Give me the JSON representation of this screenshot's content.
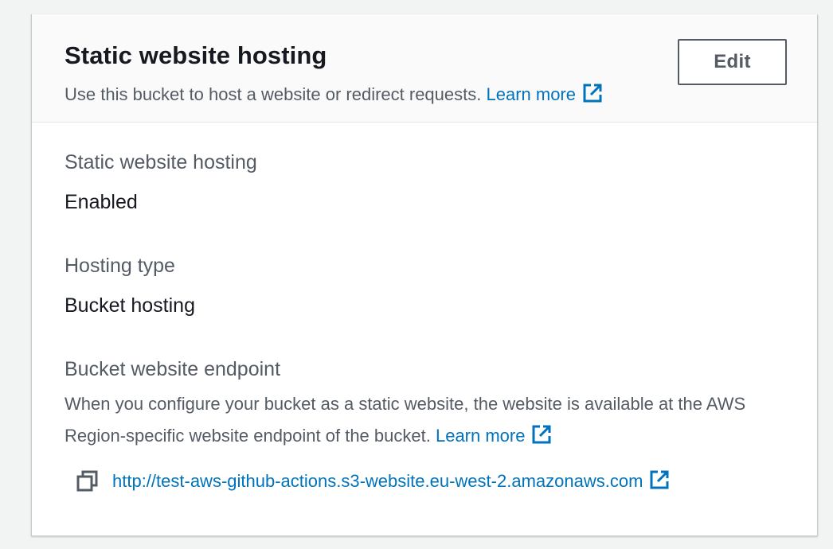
{
  "panel": {
    "title": "Static website hosting",
    "description": "Use this bucket to host a website or redirect requests.",
    "learn_more": "Learn more",
    "edit_label": "Edit"
  },
  "fields": {
    "static_hosting": {
      "label": "Static website hosting",
      "value": "Enabled"
    },
    "hosting_type": {
      "label": "Hosting type",
      "value": "Bucket hosting"
    },
    "endpoint": {
      "label": "Bucket website endpoint",
      "description": "When you configure your bucket as a static website, the website is available at the AWS Region-specific website endpoint of the bucket.",
      "learn_more": "Learn more",
      "url": "http://test-aws-github-actions.s3-website.eu-west-2.amazonaws.com"
    }
  },
  "icons": {
    "external": "external-link-icon",
    "copy": "copy-icon"
  },
  "colors": {
    "link": "#0073bb",
    "text_primary": "#16191f",
    "text_secondary": "#545b64",
    "header_bg": "#fafafa",
    "page_bg": "#f2f3f3"
  }
}
